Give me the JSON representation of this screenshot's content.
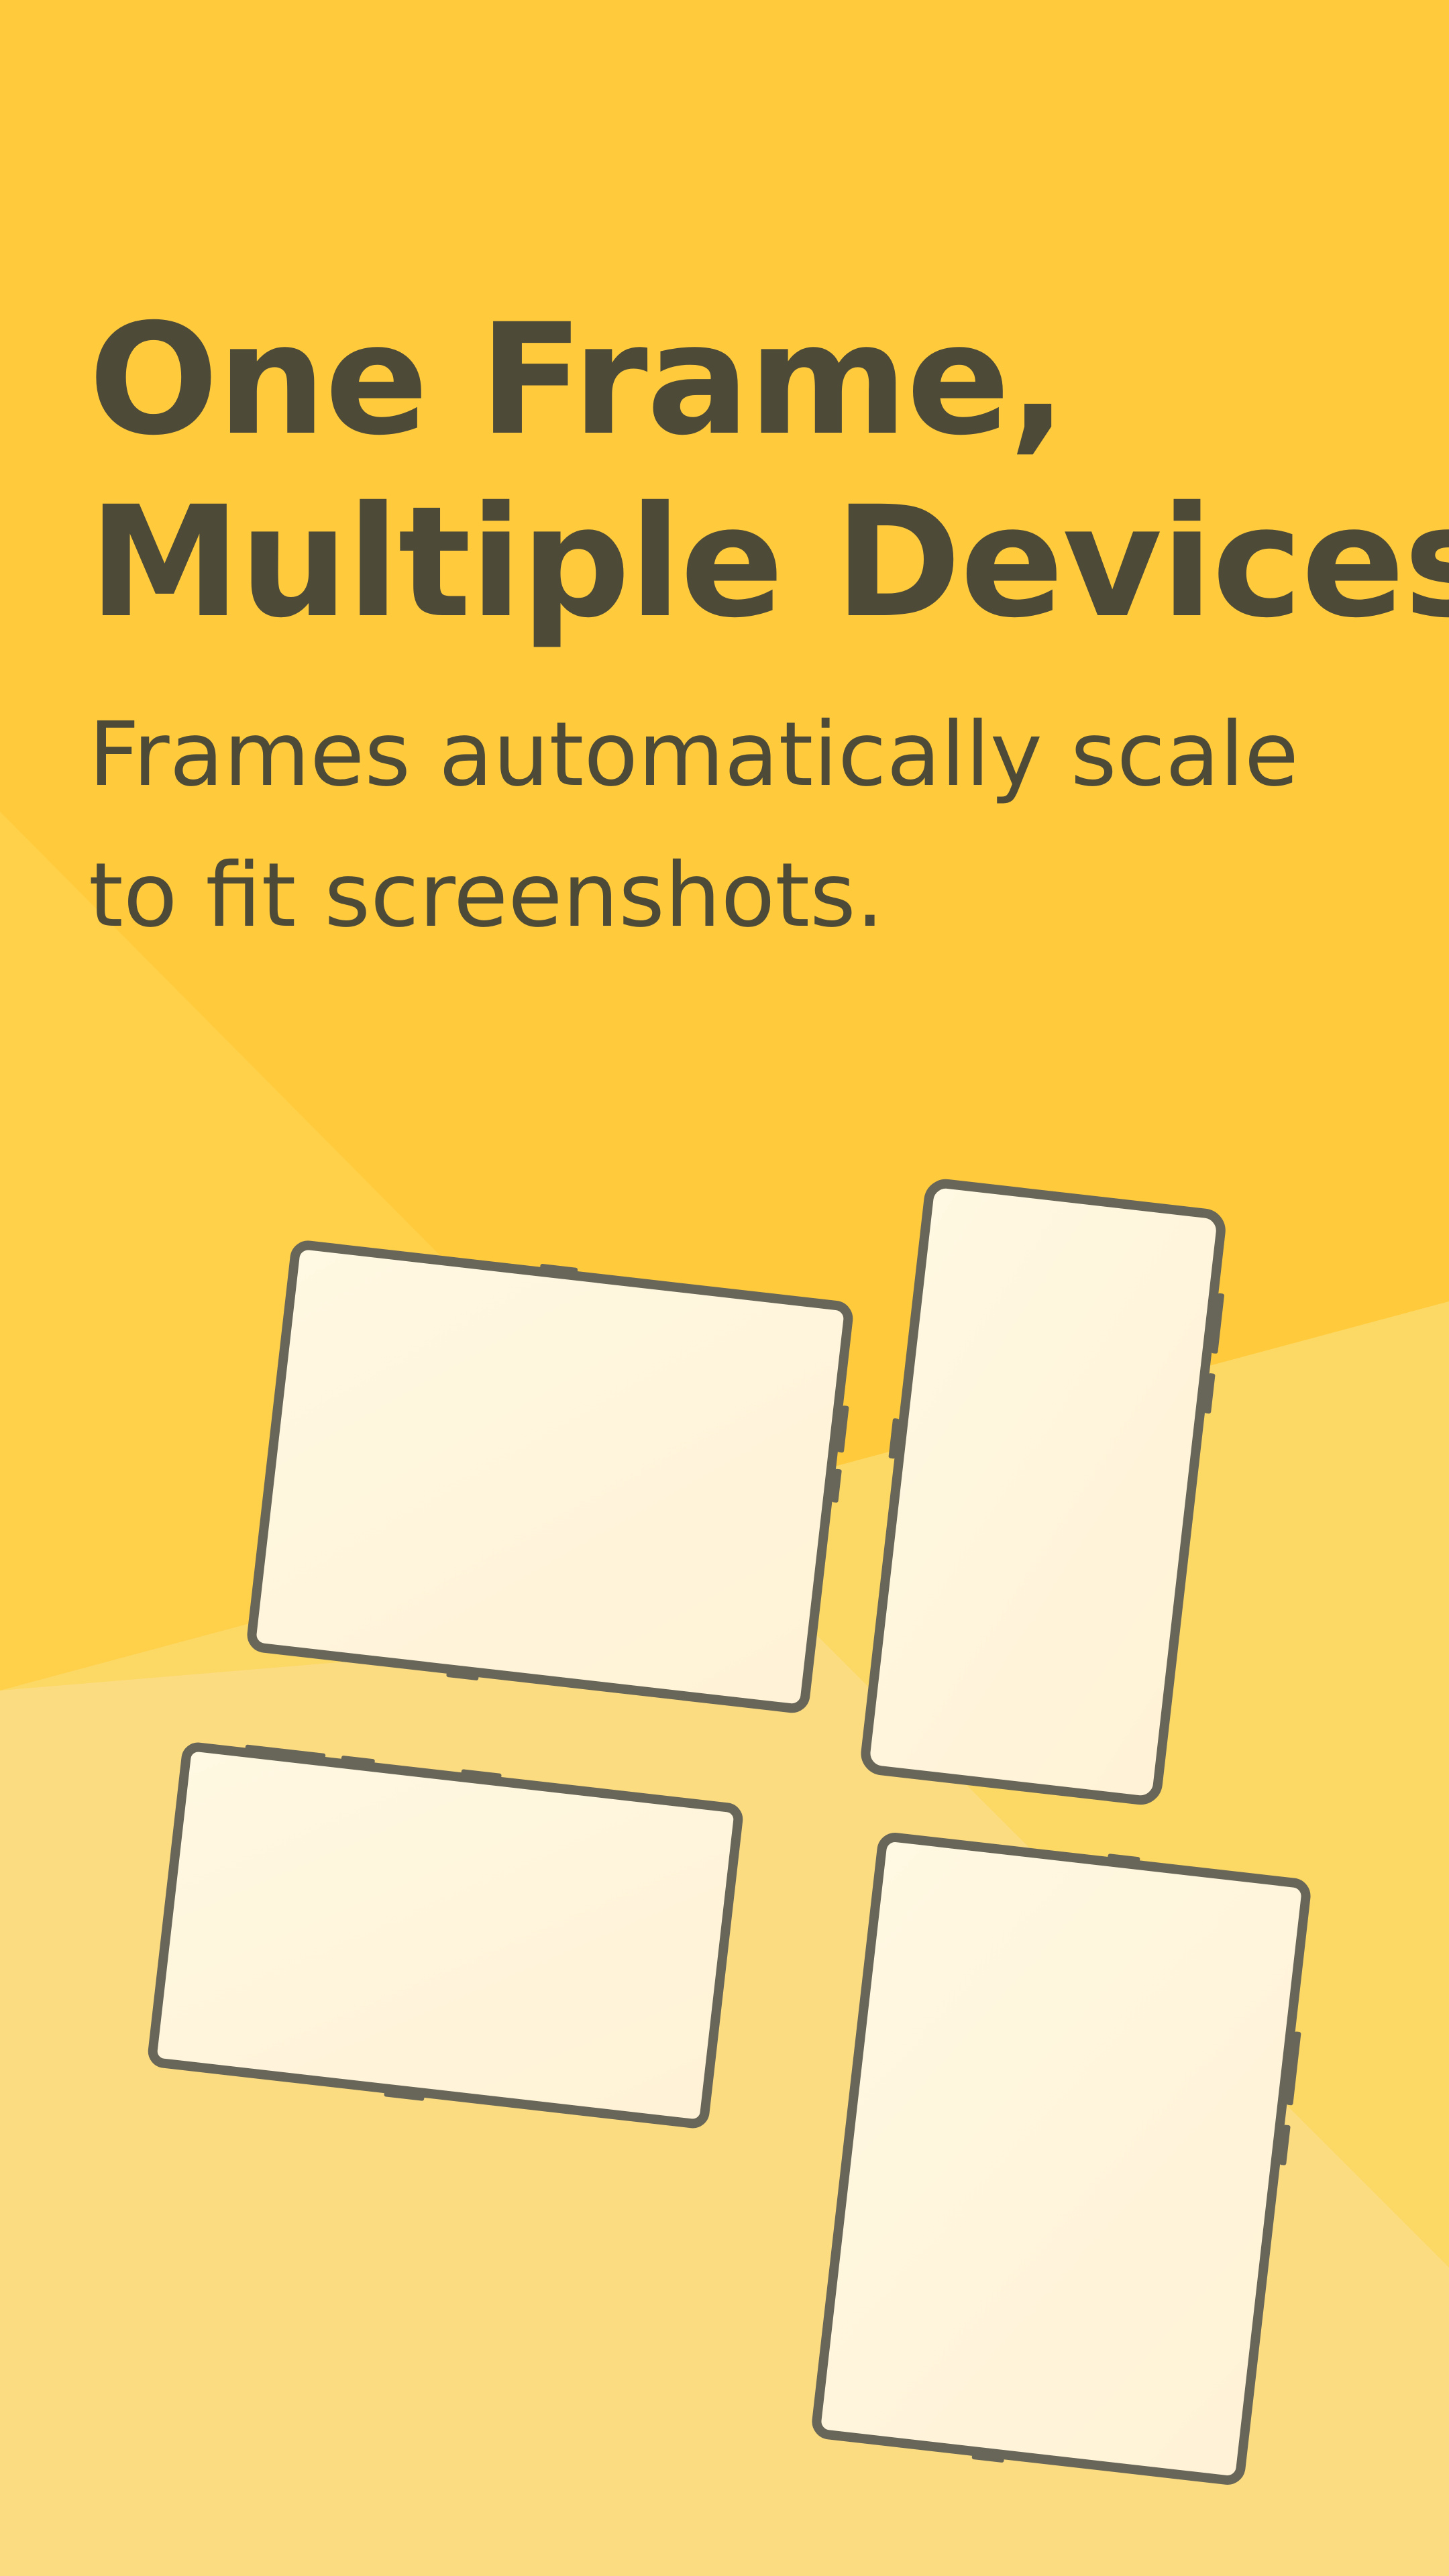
{
  "headline": {
    "line1": "One Frame,",
    "line2": "Multiple Devices"
  },
  "subtitle": {
    "line1": "Frames automatically scale",
    "line2": "to fit screenshots."
  },
  "colors": {
    "background": "#FFCB3C",
    "background_light": "#FCDC7F",
    "text": "#4D4A38",
    "frame_border": "#686658",
    "screen_fill": "#FFF6DE"
  },
  "devices": [
    {
      "kind": "tablet-landscape"
    },
    {
      "kind": "phone-portrait"
    },
    {
      "kind": "wide-landscape"
    },
    {
      "kind": "tablet-portrait"
    }
  ]
}
